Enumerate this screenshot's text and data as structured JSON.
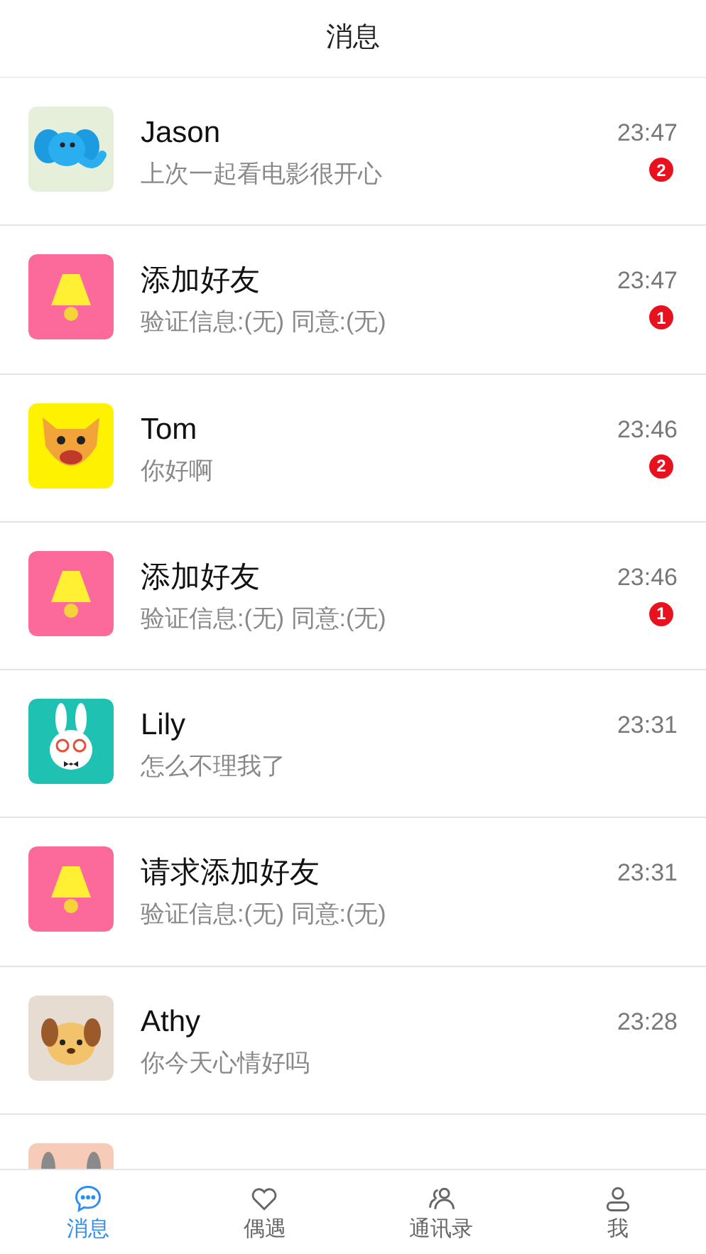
{
  "header": {
    "title": "消息"
  },
  "conversations": [
    {
      "kind": "elephant",
      "name": "Jason",
      "preview": "上次一起看电影很开心",
      "time": "23:47",
      "unread": "2"
    },
    {
      "kind": "lamp",
      "name": "添加好友",
      "preview": "验证信息:(无) 同意:(无)",
      "time": "23:47",
      "unread": "1"
    },
    {
      "kind": "leopard",
      "name": "Tom",
      "preview": "你好啊",
      "time": "23:46",
      "unread": "2"
    },
    {
      "kind": "lamp",
      "name": "添加好友",
      "preview": "验证信息:(无) 同意:(无)",
      "time": "23:46",
      "unread": "1"
    },
    {
      "kind": "rabbit",
      "name": "Lily",
      "preview": "怎么不理我了",
      "time": "23:31"
    },
    {
      "kind": "lamp",
      "name": "请求添加好友",
      "preview": "验证信息:(无) 同意:(无)",
      "time": "23:31"
    },
    {
      "kind": "dog",
      "name": "Athy",
      "preview": "你今天心情好吗",
      "time": "23:28"
    },
    {
      "kind": "bunny"
    }
  ],
  "tabs": [
    {
      "kind": "chat",
      "label": "消息",
      "selected": true
    },
    {
      "kind": "heart",
      "label": "偶遇",
      "selected": false
    },
    {
      "kind": "contacts",
      "label": "通讯录",
      "selected": false
    },
    {
      "kind": "person",
      "label": "我",
      "selected": false
    }
  ]
}
